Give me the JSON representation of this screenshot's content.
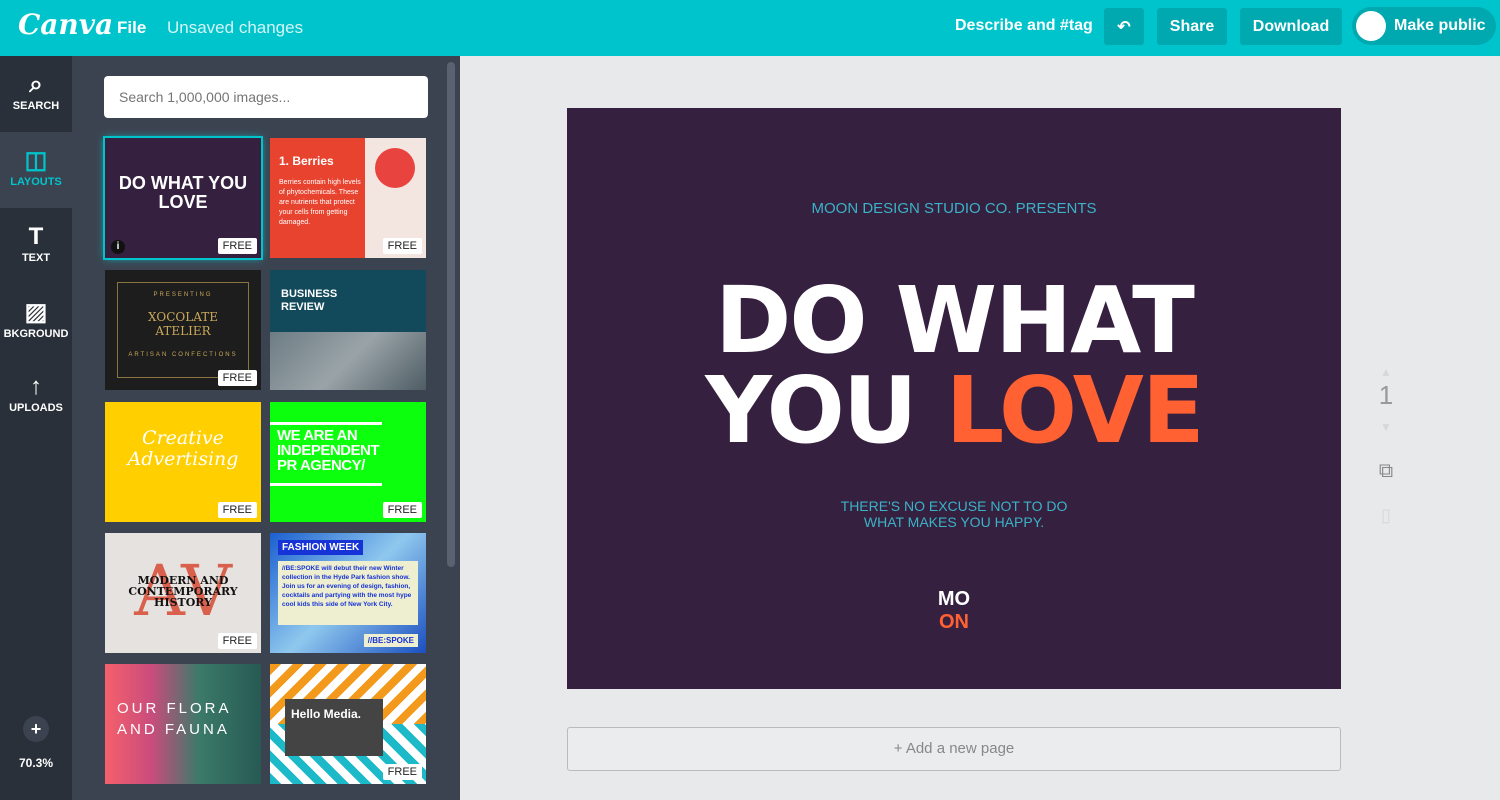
{
  "header": {
    "logo": "Canva",
    "file": "File",
    "status": "Unsaved changes",
    "describe": "Describe and #tag",
    "share": "Share",
    "download": "Download",
    "make_public": "Make public",
    "undo_icon": "undo-icon"
  },
  "nav": [
    {
      "label": "SEARCH",
      "icon": "⌕"
    },
    {
      "label": "LAYOUTS",
      "icon": "◫"
    },
    {
      "label": "TEXT",
      "icon": "T"
    },
    {
      "label": "BKGROUND",
      "icon": "▨"
    },
    {
      "label": "UPLOADS",
      "icon": "↑"
    }
  ],
  "zoom": {
    "plus": "+",
    "level": "70.3%"
  },
  "panel": {
    "search_placeholder": "Search 1,000,000 images...",
    "free": "FREE",
    "thumbs": [
      {
        "title": "DO WHAT YOU LOVE",
        "bg": "#35203f"
      },
      {
        "title": "1. Berries",
        "body": "Berries contain high levels of phytochemicals. These are nutrients that protect your cells from getting damaged.",
        "bg": "#e8432f"
      },
      {
        "title": "XOCOLATE ATELIER",
        "pre": "PRESENTING",
        "sub": "ARTISAN CONFECTIONS",
        "bg": "#1d1d1d"
      },
      {
        "title": "BUSINESS REVIEW",
        "bg": "#124a5c"
      },
      {
        "title": "Creative Advertising",
        "bg": "#ffcf00"
      },
      {
        "title": "WE ARE AN INDEPENDENT PR AGENCY/",
        "bg": "#0cff0c"
      },
      {
        "title": "MODERN AND CONTEMPORARY HISTORY",
        "bg": "#e6e2df"
      },
      {
        "title": "FASHION WEEK",
        "body": "//BE:SPOKE will debut their new Winter collection in the Hyde Park fashion show. Join us for an evening of design, fashion, cocktails and partying with the most hype cool kids this side of New York City.",
        "tag": "//BE:SPOKE",
        "bg": "#1b5fd0"
      },
      {
        "title": "OUR FLORA AND FAUNA",
        "bg": "#2c6a5e"
      },
      {
        "title": "Hello Media.",
        "bg": "#ffffff"
      }
    ]
  },
  "canvas": {
    "presents": "MOON DESIGN STUDIO CO. PRESENTS",
    "line1": "DO WHAT",
    "line2a": "YOU",
    "line2b": "LOVE",
    "sub1": "THERE'S NO EXCUSE NOT TO DO",
    "sub2": "WHAT MAKES YOU HAPPY.",
    "logo1": "MO",
    "logo2": "ON",
    "bg": "#35203f",
    "accent": "#ff6132"
  },
  "page": {
    "number": "1",
    "add_page": "+ Add a new page"
  }
}
